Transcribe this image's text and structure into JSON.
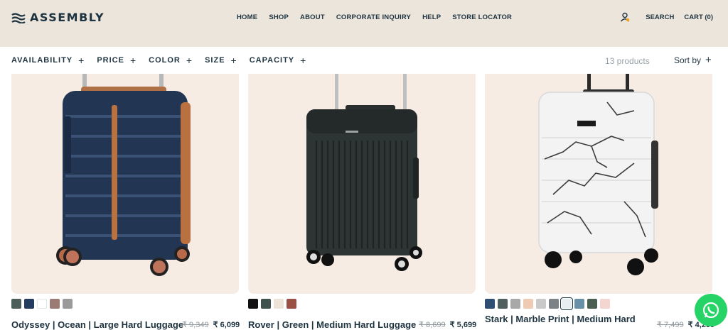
{
  "brand": {
    "name": "ASSEMBLY"
  },
  "nav": [
    "HOME",
    "SHOP",
    "ABOUT",
    "CORPORATE INQUIRY",
    "HELP",
    "STORE LOCATOR"
  ],
  "header_right": {
    "search": "SEARCH",
    "cart": "CART (0)",
    "account_icon": "user-icon"
  },
  "filters": [
    "AVAILABILITY",
    "PRICE",
    "COLOR",
    "SIZE",
    "CAPACITY"
  ],
  "product_count": "13 products",
  "sort_label": "Sort by",
  "products": [
    {
      "title": "Odyssey | Ocean | Large Hard Luggage",
      "old_price": "₹ 9,349",
      "price": "₹ 6,099",
      "swatches": [
        "#4b5e5a",
        "#243c5e",
        "#ffffff",
        "#9b7c74",
        "#9a9a9a"
      ]
    },
    {
      "title": "Rover | Green | Medium Hard Luggage",
      "old_price": "₹ 8,699",
      "price": "₹ 5,699",
      "swatches": [
        "#111111",
        "#3f524d",
        "#ede3d6",
        "#9c4f45"
      ]
    },
    {
      "title": "Stark | Marble Print | Medium Hard",
      "old_price": "₹ 7,499",
      "price": "₹ 4,299",
      "swatches": [
        "#2e4f73",
        "#51605f",
        "#a8a8a8",
        "#efcbb3",
        "#c9c9c9",
        "#7b8389",
        "#e8eef0",
        "#6a8fa8",
        "#4b5e52",
        "#f3d6cf"
      ]
    }
  ],
  "whatsapp_icon": "whatsapp-icon"
}
